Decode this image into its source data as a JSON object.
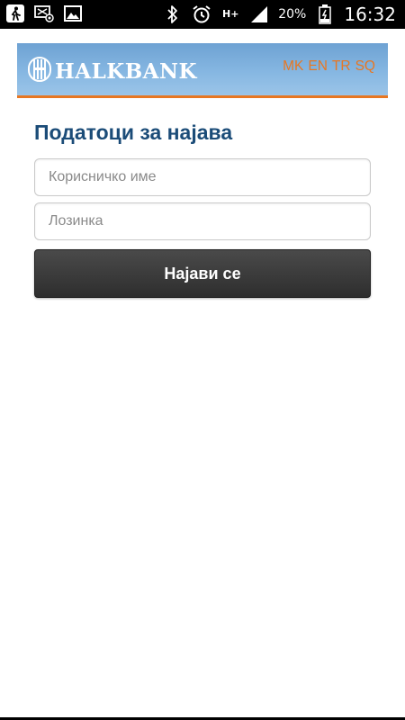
{
  "status_bar": {
    "battery": "20%",
    "time": "16:32",
    "network": "H+",
    "icons": [
      "walk-icon",
      "screencast-icon",
      "image-icon",
      "bluetooth-icon",
      "alarm-icon",
      "network-hplus-icon",
      "signal-icon",
      "battery-icon"
    ]
  },
  "header": {
    "logo_text": "HALKBANK",
    "languages": [
      "MK",
      "EN",
      "TR",
      "SQ"
    ],
    "colors": {
      "header": "#86b7e2",
      "accent": "#e87722"
    }
  },
  "login": {
    "title": "Податоци за најава",
    "username_placeholder": "Корисничко име",
    "username_value": "",
    "password_placeholder": "Лозинка",
    "password_value": "",
    "submit_label": "Најави се",
    "colors": {
      "title": "#1b4c78",
      "button": "#333333"
    }
  }
}
